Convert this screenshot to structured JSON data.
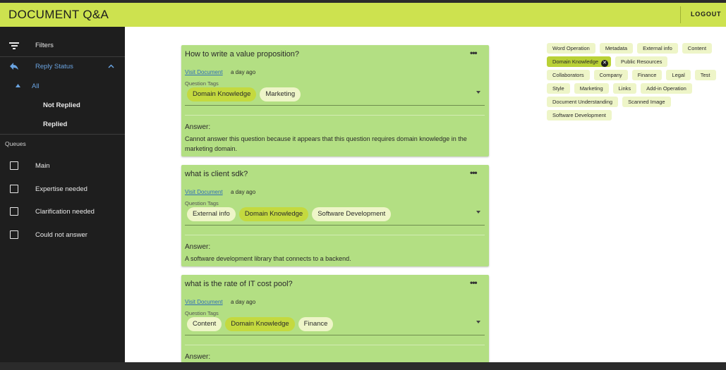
{
  "app": {
    "title": "DOCUMENT Q&A",
    "logout_label": "LOGOUT"
  },
  "sidebar": {
    "filters_label": "Filters",
    "reply_status_label": "Reply Status",
    "reply_options": [
      "All",
      "Not Replied",
      "Replied"
    ],
    "queues_label": "Queues",
    "queues": [
      "Main",
      "Expertise needed",
      "Clarification needed",
      "Could not answer"
    ]
  },
  "cards": [
    {
      "question": "How to write a value proposition?",
      "visit_label": "Visit Document",
      "time": "a day ago",
      "tags_label": "Question Tags",
      "tags": [
        {
          "label": "Domain Knowledge",
          "selected": true
        },
        {
          "label": "Marketing",
          "selected": false
        }
      ],
      "answer_label": "Answer:",
      "answer": "Cannot answer this question because it appears that this question requires domain knowledge in the marketing domain."
    },
    {
      "question": "what is client sdk?",
      "visit_label": "Visit Document",
      "time": "a day ago",
      "tags_label": "Question Tags",
      "tags": [
        {
          "label": "External info",
          "selected": false
        },
        {
          "label": "Domain Knowledge",
          "selected": true
        },
        {
          "label": "Software Development",
          "selected": false
        }
      ],
      "answer_label": "Answer:",
      "answer": "A software development library that connects to a backend."
    },
    {
      "question": "what is the rate of IT cost pool?",
      "visit_label": "Visit Document",
      "time": "a day ago",
      "tags_label": "Question Tags",
      "tags": [
        {
          "label": "Content",
          "selected": false
        },
        {
          "label": "Domain Knowledge",
          "selected": true
        },
        {
          "label": "Finance",
          "selected": false
        }
      ],
      "answer_label": "Answer:",
      "answer": ""
    }
  ],
  "tag_filter": {
    "rows": [
      [
        {
          "label": "Word Operation"
        },
        {
          "label": "Metadata"
        },
        {
          "label": "External info"
        },
        {
          "label": "Content"
        }
      ],
      [
        {
          "label": "Domain Knowledge",
          "selected": true
        },
        {
          "label": "Public Resources"
        }
      ],
      [
        {
          "label": "Collaborators"
        },
        {
          "label": "Company"
        },
        {
          "label": "Finance"
        },
        {
          "label": "Legal"
        },
        {
          "label": "Test"
        }
      ],
      [
        {
          "label": "Style"
        },
        {
          "label": "Marketing"
        },
        {
          "label": "Links"
        },
        {
          "label": "Add-in Operation"
        }
      ],
      [
        {
          "label": "Document Understanding"
        },
        {
          "label": "Scanned Image"
        }
      ],
      [
        {
          "label": "Software Development"
        }
      ]
    ]
  },
  "colors": {
    "accent": "#cde24f",
    "card": "#b3df83",
    "sidebar": "#1e1e1e",
    "link": "#2f6fb7",
    "reply_status": "#6aa3e0"
  }
}
